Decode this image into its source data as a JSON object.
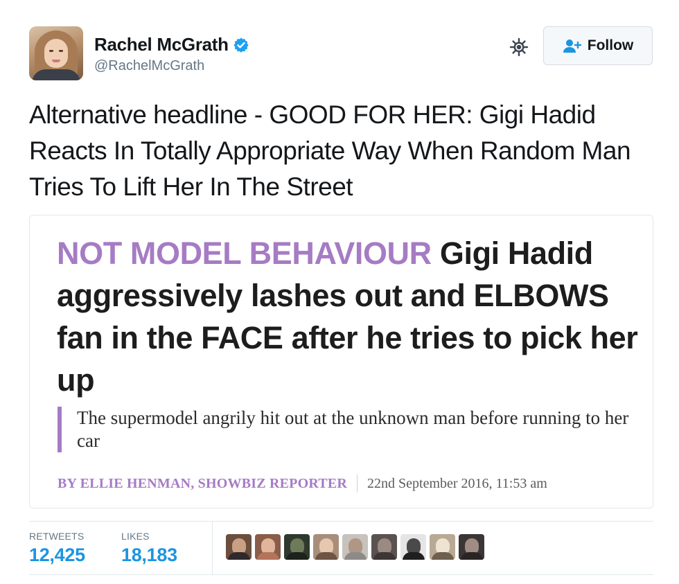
{
  "user": {
    "name": "Rachel McGrath",
    "handle": "@RachelMcGrath",
    "verified": true
  },
  "actions": {
    "follow_label": "Follow"
  },
  "tweet": {
    "text": "Alternative headline - GOOD FOR HER: Gigi Hadid Reacts In Totally Appropriate Way When Random Man Tries To Lift Her In The Street"
  },
  "card": {
    "kicker": "NOT MODEL BEHAVIOUR",
    "headline": "Gigi Hadid aggressively lashes out and ELBOWS fan in the FACE after he tries to pick her up",
    "subheading": "The supermodel angrily hit out at the unknown man before running to her car",
    "byline": "BY ELLIE HENMAN, SHOWBIZ REPORTER",
    "date": "22nd September 2016, 11:53 am"
  },
  "stats": {
    "retweets_label": "RETWEETS",
    "retweets": "12,425",
    "likes_label": "LIKES",
    "likes": "18,183"
  },
  "colors": {
    "accent_purple": "#a67bc4",
    "link_blue": "#1b95e0",
    "muted": "#657786"
  },
  "icons": {
    "verified": "verified-badge-icon",
    "gear": "gear-icon",
    "follow": "add-user-icon"
  },
  "likers": [
    {
      "bg": "#6b4e3d",
      "head": "#caa083",
      "body": "#2e2a2b"
    },
    {
      "bg": "#8a5d4a",
      "head": "#e0b59a",
      "body": "#b3745b"
    },
    {
      "bg": "#2f3a2e",
      "head": "#6f7a5a",
      "body": "#1d221b"
    },
    {
      "bg": "#a88e7a",
      "head": "#e7c7ae",
      "body": "#6d5444"
    },
    {
      "bg": "#c8c2bd",
      "head": "#b09685",
      "body": "#8d8b8a"
    },
    {
      "bg": "#5a5250",
      "head": "#9a8a82",
      "body": "#3d3635"
    },
    {
      "bg": "#e5e5e5",
      "head": "#4a4a4a",
      "body": "#1f1f1f"
    },
    {
      "bg": "#b9a994",
      "head": "#efe3d2",
      "body": "#6e5f4f"
    },
    {
      "bg": "#3b3535",
      "head": "#9f8c84",
      "body": "#2a2525"
    }
  ]
}
